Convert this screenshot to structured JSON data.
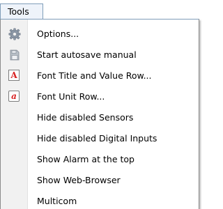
{
  "menubar": {
    "title": "Tools"
  },
  "menu": {
    "items": [
      {
        "label": "Options...",
        "icon": "gear-icon"
      },
      {
        "label": "Start autosave manual",
        "icon": "disk-icon"
      },
      {
        "label": "Font Title and Value Row...",
        "icon": "font-a-icon",
        "glyph": "A"
      },
      {
        "label": "Font Unit Row...",
        "icon": "font-a-italic-icon",
        "glyph": "a"
      },
      {
        "label": "Hide disabled Sensors"
      },
      {
        "label": "Hide disabled Digital Inputs"
      },
      {
        "label": "Show Alarm at the top"
      },
      {
        "label": "Show Web-Browser"
      },
      {
        "label": "Multicom"
      }
    ]
  },
  "colors": {
    "gutter": "#f1f1f1",
    "highlight_border": "#7f9db9",
    "font_icon_red": "#d81f1f"
  }
}
